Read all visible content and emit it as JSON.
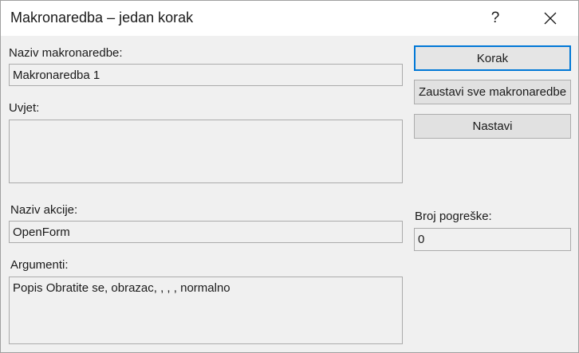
{
  "window": {
    "title": "Makronaredba – jedan korak",
    "help_label": "?"
  },
  "fields": {
    "macro_name_label": "Naziv makronaredbe:",
    "macro_name_value": "Makronaredba 1",
    "condition_label": "Uvjet:",
    "condition_value": "",
    "action_name_label": "Naziv akcije:",
    "action_name_value": "OpenForm",
    "arguments_label": "Argumenti:",
    "arguments_value": "Popis Obratite se, obrazac, , , , normalno",
    "error_number_label": "Broj pogreške:",
    "error_number_value": "0"
  },
  "buttons": {
    "step": "Korak",
    "stop_all": "Zaustavi sve makronaredbe",
    "continue": "Nastavi"
  },
  "icons": {
    "close": "close-icon"
  }
}
